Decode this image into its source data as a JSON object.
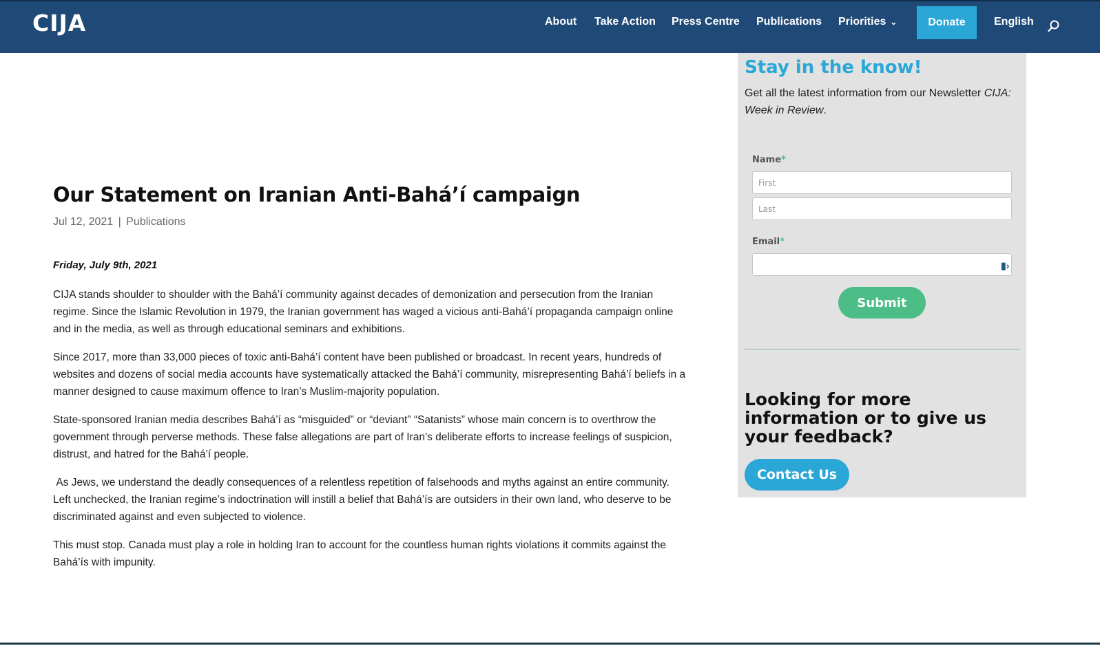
{
  "header": {
    "logo": "CIJA",
    "nav": [
      {
        "label": "About"
      },
      {
        "label": "Take Action"
      },
      {
        "label": "Press Centre"
      },
      {
        "label": "Publications"
      },
      {
        "label": "Priorities"
      }
    ],
    "donate_label": "Donate",
    "language_label": "English"
  },
  "article": {
    "title": "Our Statement on Iranian Anti-Bahá’í campaign",
    "date": "Jul 12, 2021",
    "separator": "|",
    "category": "Publications",
    "date_line": "Friday, July 9th, 2021",
    "paragraphs": [
      "CIJA stands shoulder to shoulder with the Bahá’í community against decades of demonization and persecution from the Iranian regime. Since the Islamic Revolution in 1979, the Iranian government has waged a vicious anti-Bahá’í propaganda campaign online and in the media, as well as through educational seminars and exhibitions.",
      "Since 2017, more than 33,000 pieces of toxic anti-Bahá’í content have been published or broadcast. In recent years, hundreds of websites and dozens of social media accounts have systematically attacked the Bahá’í community, misrepresenting Bahá’í beliefs in a manner designed to cause maximum offence to Iran’s Muslim-majority population.",
      "State-sponsored Iranian media describes Bahá’í as “misguided” or “deviant” “Satanists” whose main concern is to overthrow the government through perverse methods. These false allegations are part of Iran’s deliberate efforts to increase feelings of suspicion, distrust, and hatred for the Bahá’í people.",
      " As Jews, we understand the deadly consequences of a relentless repetition of falsehoods and myths against an entire community. Left unchecked, the Iranian regime’s indoctrination will instill a belief that Bahá’ís are outsiders in their own land, who deserve to be discriminated against and even subjected to violence.",
      "This must stop. Canada must play a role in holding Iran to account for the countless human rights violations it commits against the Bahá’ís with impunity."
    ]
  },
  "sidebar": {
    "heading": "Stay in the know!",
    "description_prefix": "Get all the latest information from our Newsletter ",
    "description_italic": "CIJA: Week in Review",
    "description_suffix": ".",
    "form": {
      "name_label": "Name",
      "required_mark": "*",
      "first_placeholder": "First",
      "last_placeholder": "Last",
      "email_label": "Email",
      "submit_label": "Submit"
    },
    "more_info_heading": "Looking for more information or to give us your feedback?",
    "contact_label": "Contact Us"
  },
  "colors": {
    "header_bg": "#1f4a78",
    "accent_blue": "#2aa7d6",
    "submit_green": "#4cbd86",
    "sidebar_bg": "#e2e2e2"
  }
}
